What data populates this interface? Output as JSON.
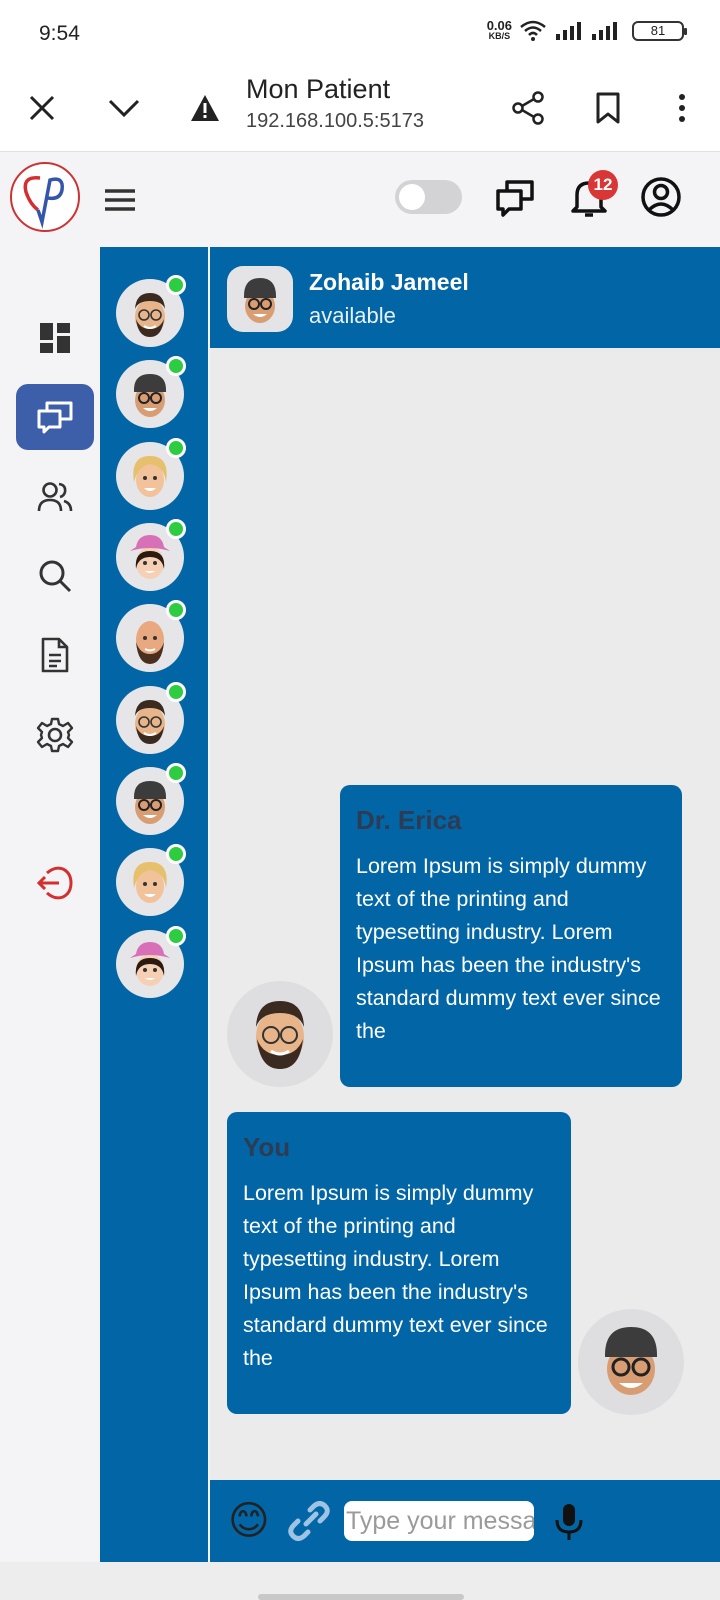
{
  "status_bar": {
    "time": "9:54",
    "net_speed": "0.06",
    "net_unit": "KB/S",
    "battery": "81"
  },
  "browser": {
    "title": "Mon Patient",
    "url": "192.168.100.5:5173"
  },
  "header": {
    "notification_count": "12"
  },
  "nav": {
    "items": [
      "dashboard-icon",
      "chat-icon",
      "users-icon",
      "search-icon",
      "document-icon",
      "settings-icon",
      "logout-icon"
    ],
    "active": "chat-icon"
  },
  "contacts": {
    "count": 9,
    "online": [
      true,
      true,
      true,
      true,
      true,
      true,
      true,
      true,
      true
    ]
  },
  "chat": {
    "contact_name": "Zohaib Jameel",
    "contact_status": "available",
    "messages": [
      {
        "sender": "Dr. Erica",
        "text": "Lorem Ipsum is simply dummy text of the printing and typesetting industry. Lorem Ipsum has been the industry's standard dummy text ever since the"
      },
      {
        "sender": "You",
        "text": "Lorem Ipsum is simply dummy text of the printing and typesetting industry. Lorem Ipsum has been the industry's standard dummy text ever since the"
      }
    ],
    "input": {
      "placeholder": "Type your message",
      "value": ""
    },
    "emoji": "😊"
  },
  "colors": {
    "primary": "#0266a6",
    "nav_active": "#3d5ea8",
    "online": "#2ecc40",
    "badge": "#d93636",
    "logout": "#d32f2f",
    "sender_name": "#2c3c55"
  }
}
